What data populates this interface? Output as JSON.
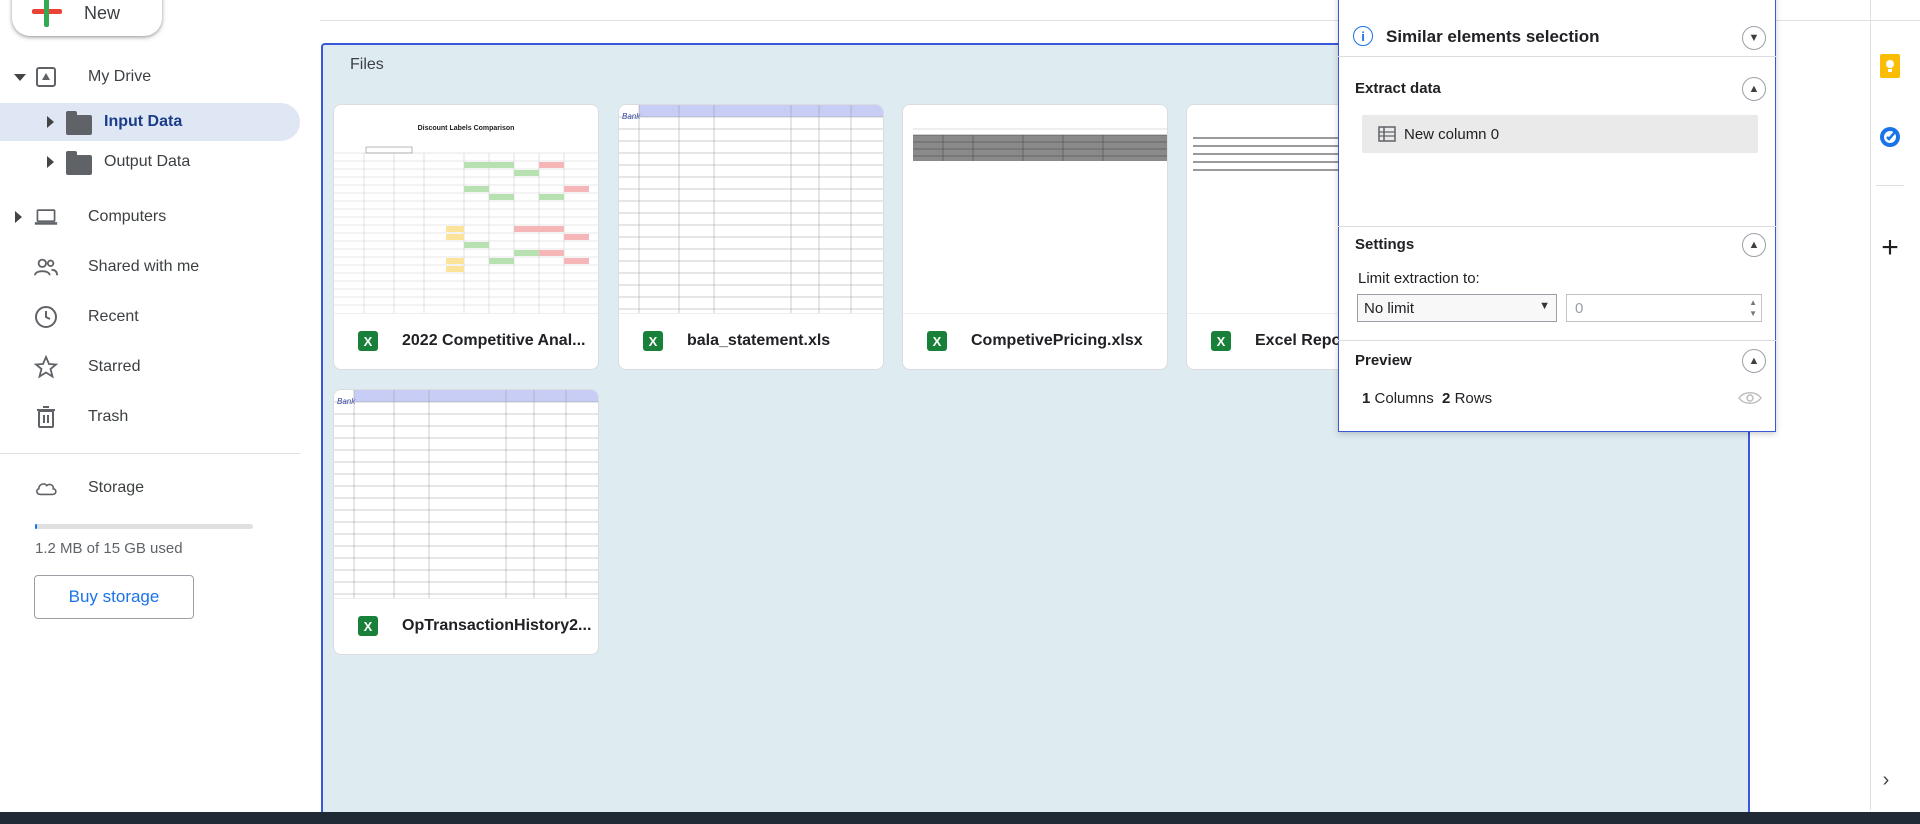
{
  "new_button": {
    "label": "New"
  },
  "sidebar": {
    "my_drive": "My Drive",
    "folders": [
      {
        "label": "Input Data",
        "selected": true
      },
      {
        "label": "Output Data",
        "selected": false
      }
    ],
    "computers": "Computers",
    "shared": "Shared with me",
    "recent": "Recent",
    "starred": "Starred",
    "trash": "Trash",
    "storage": "Storage",
    "storage_used": "1.2 MB of 15 GB used",
    "buy_storage": "Buy storage"
  },
  "main": {
    "section_title": "Files",
    "files": [
      {
        "name": "2022 Competitive Anal...",
        "thumb_title": "Discount Labels Comparison"
      },
      {
        "name": "bala_statement.xls"
      },
      {
        "name": "CompetivePricing.xlsx"
      },
      {
        "name": "Excel Repo"
      },
      {
        "name": "OpTransactionHistory2..."
      }
    ]
  },
  "panel": {
    "similar": "Similar elements selection",
    "extract": "Extract data",
    "column_chip": "New column 0",
    "settings": "Settings",
    "limit_label": "Limit extraction to:",
    "limit_value": "No limit",
    "limit_number": "0",
    "preview": "Preview",
    "preview_cols_num": "1",
    "preview_cols_label": "Columns",
    "preview_rows_num": "2",
    "preview_rows_label": "Rows"
  },
  "colors": {
    "accent": "#1a73e8",
    "selected_bg": "#dfe7f5",
    "drop_zone_bg": "#deecf2",
    "drop_zone_border": "#3b57d9",
    "excel_green": "#188038"
  }
}
